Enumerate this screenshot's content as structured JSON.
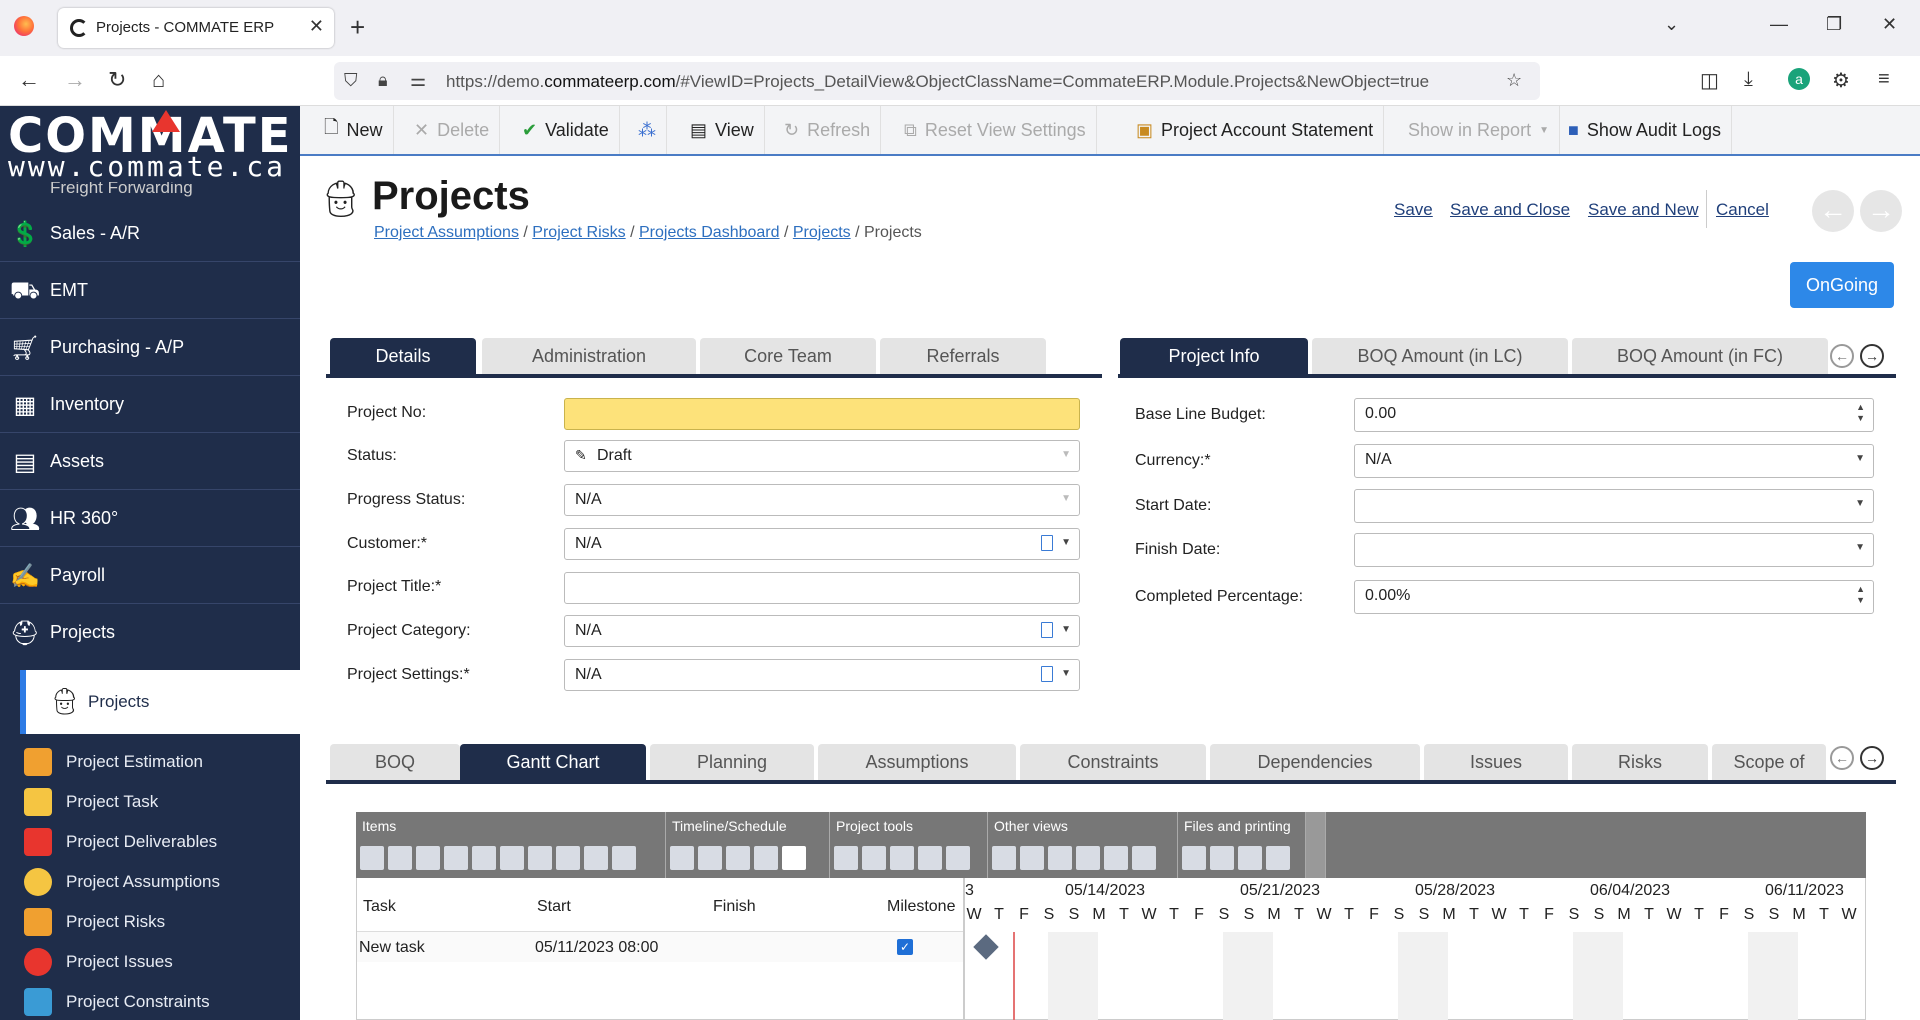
{
  "browser": {
    "tab_title": "Projects - COMMATE ERP",
    "url_prefix": "https://demo.",
    "url_domain": "commateerp.com",
    "url_rest": "/#ViewID=Projects_DetailView&ObjectClassName=CommateERP.Module.Projects&NewObject=true"
  },
  "logo": {
    "main": "COMMATE",
    "sub": "www.commate.ca"
  },
  "sidebar": {
    "partial_label": "Freight Forwarding",
    "items": [
      {
        "label": "Sales - A/R",
        "icon": "sales-icon"
      },
      {
        "label": "EMT",
        "icon": "truck-icon"
      },
      {
        "label": "Purchasing - A/P",
        "icon": "cart-icon"
      },
      {
        "label": "Inventory",
        "icon": "forklift-icon"
      },
      {
        "label": "Assets",
        "icon": "assets-icon"
      },
      {
        "label": "HR 360°",
        "icon": "people-icon"
      },
      {
        "label": "Payroll",
        "icon": "payroll-icon"
      },
      {
        "label": "Projects",
        "icon": "hardhat-icon"
      }
    ],
    "sub_active": "Projects",
    "sub_items": [
      {
        "label": "Project Estimation",
        "color": "#f0a030"
      },
      {
        "label": "Project Task",
        "color": "#f5c542"
      },
      {
        "label": "Project Deliverables",
        "color": "#e8352e"
      },
      {
        "label": "Project Assumptions",
        "color": "#f5c542"
      },
      {
        "label": "Project Risks",
        "color": "#f0a030"
      },
      {
        "label": "Project Issues",
        "color": "#e8352e"
      },
      {
        "label": "Project Constraints",
        "color": "#3a9bd5"
      }
    ]
  },
  "toolbar": {
    "new": "New",
    "delete": "Delete",
    "validate": "Validate",
    "view": "View",
    "refresh": "Refresh",
    "reset": "Reset View Settings",
    "statement": "Project Account Statement",
    "show_in_report": "Show in Report",
    "audit": "Show Audit Logs"
  },
  "page": {
    "title": "Projects",
    "breadcrumb": [
      "Project Assumptions",
      "Project Risks",
      "Projects Dashboard",
      "Projects"
    ],
    "breadcrumb_current": "Projects",
    "save": "Save",
    "save_close": "Save and Close",
    "save_new": "Save and New",
    "cancel": "Cancel",
    "status_button": "OnGoing"
  },
  "left_tabs": [
    "Details",
    "Administration",
    "Core Team",
    "Referrals"
  ],
  "right_tabs": [
    "Project Info",
    "BOQ Amount (in LC)",
    "BOQ Amount (in FC)"
  ],
  "form_left": {
    "project_no": {
      "label": "Project No:",
      "value": ""
    },
    "status": {
      "label": "Status:",
      "value": "Draft"
    },
    "progress": {
      "label": "Progress Status:",
      "value": "N/A"
    },
    "customer": {
      "label": "Customer:*",
      "value": "N/A"
    },
    "title": {
      "label": "Project Title:*",
      "value": ""
    },
    "category": {
      "label": "Project Category:",
      "value": "N/A"
    },
    "settings": {
      "label": "Project Settings:*",
      "value": "N/A"
    }
  },
  "form_right": {
    "budget": {
      "label": "Base Line Budget:",
      "value": "0.00"
    },
    "currency": {
      "label": "Currency:*",
      "value": "N/A"
    },
    "start": {
      "label": "Start Date:",
      "value": ""
    },
    "finish": {
      "label": "Finish Date:",
      "value": ""
    },
    "completed": {
      "label": "Completed Percentage:",
      "value": "0.00%"
    }
  },
  "bottom_tabs": [
    "BOQ",
    "Gantt Chart",
    "Planning",
    "Assumptions",
    "Constraints",
    "Dependencies",
    "Issues",
    "Risks",
    "Scope of"
  ],
  "gantt": {
    "groups": [
      "Items",
      "Timeline/Schedule",
      "Project tools",
      "Other views",
      "Files and printing"
    ],
    "columns": {
      "task": "Task",
      "start": "Start",
      "finish": "Finish",
      "milestone": "Milestone"
    },
    "row": {
      "task": "New task",
      "start": "05/11/2023 08:00",
      "finish": "",
      "milestone": true
    },
    "timeline_first": "3",
    "dates": [
      "05/14/2023",
      "05/21/2023",
      "05/28/2023",
      "06/04/2023",
      "06/11/2023"
    ],
    "days": [
      "W",
      "T",
      "F",
      "S",
      "S",
      "M",
      "T",
      "W",
      "T",
      "F",
      "S",
      "S",
      "M",
      "T",
      "W",
      "T",
      "F",
      "S",
      "S",
      "M",
      "T",
      "W",
      "T",
      "F",
      "S",
      "S",
      "M",
      "T",
      "W",
      "T",
      "F",
      "S",
      "S",
      "M",
      "T",
      "W"
    ]
  }
}
